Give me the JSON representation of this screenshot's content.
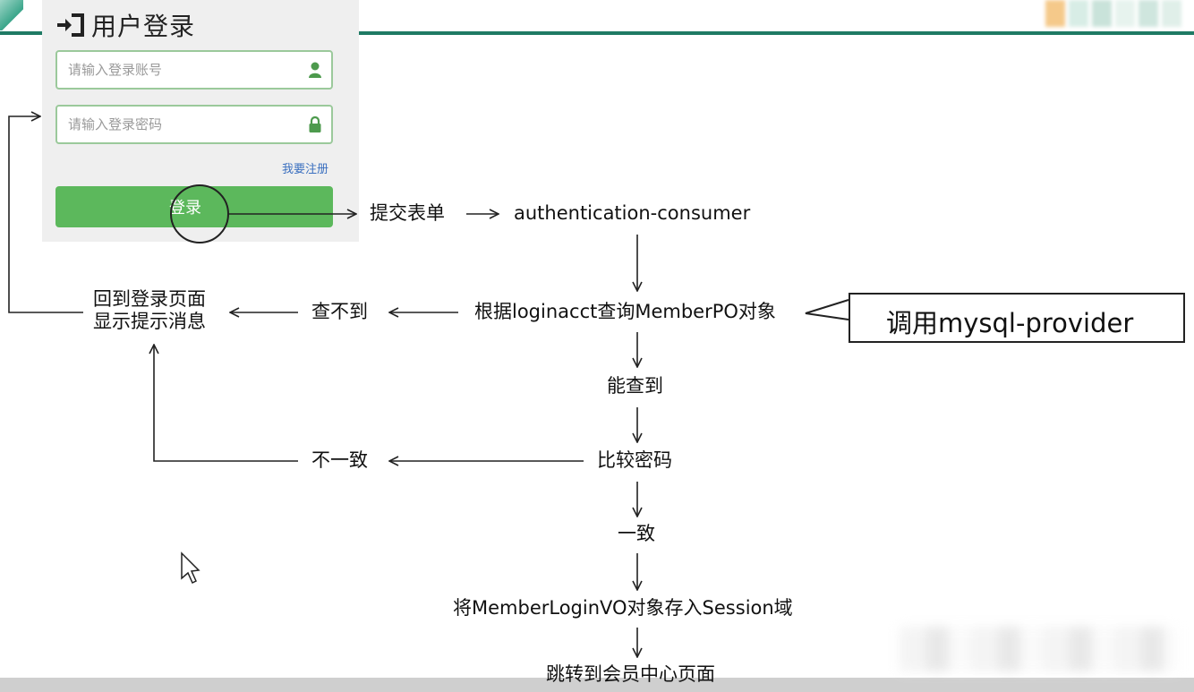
{
  "colors": {
    "accent_rule": "#1f7a64",
    "login_button": "#5cb85c",
    "field_border": "#9bc99b",
    "panel_bg": "#efefef",
    "link": "#3a6fbf"
  },
  "login_form": {
    "title": "用户登录",
    "title_icon": "sign-in-icon",
    "account_placeholder": "请输入登录账号",
    "account_icon": "user-icon",
    "password_placeholder": "请输入登录密码",
    "password_icon": "lock-icon",
    "register_link": "我要注册",
    "login_button": "登录"
  },
  "flow": {
    "submit_form": "提交表单",
    "auth_consumer": "authentication-consumer",
    "query_member": "根据loginacct查询MemberPO对象",
    "callout": "调用mysql-provider",
    "not_found": "查不到",
    "back_to_login_line1": "回到登录页面",
    "back_to_login_line2": "显示提示消息",
    "found": "能查到",
    "compare_password": "比较密码",
    "mismatch": "不一致",
    "match": "一致",
    "store_session": "将MemberLoginVO对象存入Session域",
    "redirect_member_center": "跳转到会员中心页面"
  },
  "overlay_icons": [
    "mouse-cursor-icon"
  ]
}
